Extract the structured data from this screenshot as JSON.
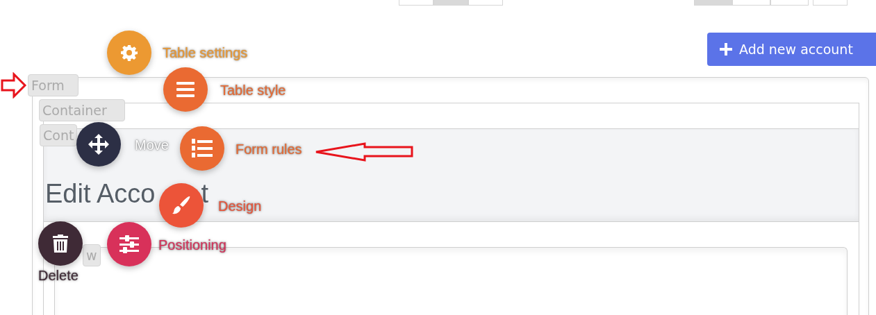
{
  "top_controls": [
    {
      "segments": [
        {
          "selected": false
        },
        {
          "selected": true
        },
        {
          "selected": false
        }
      ]
    },
    {
      "segments": [
        {
          "selected": true
        },
        {
          "selected": false
        },
        {
          "selected": false
        }
      ]
    },
    {
      "segments": [
        {
          "selected": false
        }
      ]
    }
  ],
  "add_button": {
    "label": "Add new account"
  },
  "layout_tags": [
    "Form",
    "Container",
    "Cont",
    "w"
  ],
  "heading": [
    "Edit Acco",
    "t"
  ],
  "action_menu": [
    {
      "label": "Table settings",
      "color": "#ec9932",
      "kind": "side"
    },
    {
      "label": "Table style",
      "color": "#ea6a32",
      "kind": "side"
    },
    {
      "label": "Move",
      "color": "#2c2f45",
      "kind": "inside"
    },
    {
      "label": "Form rules",
      "color": "#ea6a32",
      "kind": "side"
    },
    {
      "label": "Design",
      "color": "#ec5439",
      "kind": "side"
    },
    {
      "label": "Positioning",
      "color": "#d8315a",
      "kind": "side"
    },
    {
      "label": "Delete",
      "color": "#3f2a36",
      "kind": "below"
    }
  ]
}
